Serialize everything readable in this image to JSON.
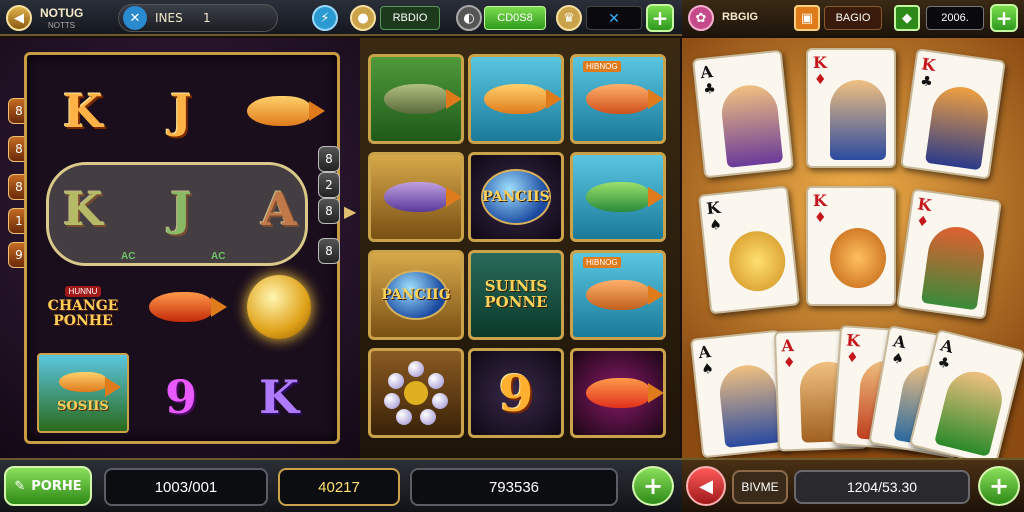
{
  "topbar": {
    "logo_title": "NOTUG",
    "logo_sub": "NOTTS",
    "lines_label": "INES",
    "lines_value": "1",
    "mode_label": "RBDIO",
    "coins_value": "CD0S8",
    "right_label": "RBGIG",
    "bonus_label": "BAGIO",
    "balance_value": "2006."
  },
  "slot": {
    "rows": [
      [
        "K",
        "J",
        ""
      ],
      [
        "K",
        "J",
        "A"
      ],
      [
        "",
        "",
        ""
      ],
      [
        "",
        "9",
        "K"
      ]
    ],
    "left_numbers": [
      "8",
      "8",
      "8",
      "1",
      "9"
    ],
    "right_numbers": [
      "8",
      "2",
      "8",
      "8"
    ],
    "win_tags": [
      "AC",
      "AC"
    ],
    "banner_tag": "HUNNU",
    "banner_text": "CHANGE PONHE",
    "bottom_banner": "SOSIIS"
  },
  "grid": {
    "tiles": [
      {
        "label": "",
        "tag": ""
      },
      {
        "label": "",
        "tag": ""
      },
      {
        "label": "",
        "tag": "HIBNOG"
      },
      {
        "label": "",
        "tag": ""
      },
      {
        "label": "PANCIIS",
        "tag": ""
      },
      {
        "label": "",
        "tag": ""
      },
      {
        "label": "PANCIIG",
        "tag": ""
      },
      {
        "label": "SUINIS PONNE",
        "tag": ""
      },
      {
        "label": "",
        "tag": "HIBNOG"
      },
      {
        "label": "",
        "tag": ""
      },
      {
        "label": "9",
        "tag": ""
      },
      {
        "label": "",
        "tag": ""
      }
    ]
  },
  "cards": {
    "row1": [
      {
        "rank": "A",
        "color": "black"
      },
      {
        "rank": "K",
        "color": "red"
      },
      {
        "rank": "K",
        "color": "red"
      }
    ],
    "row2": [
      {
        "rank": "K",
        "color": "black"
      },
      {
        "rank": "K",
        "color": "red"
      },
      {
        "rank": "K",
        "color": "red"
      }
    ],
    "row3": [
      {
        "rank": "A",
        "color": "black"
      },
      {
        "rank": "A",
        "color": "red"
      },
      {
        "rank": "K",
        "color": "red"
      },
      {
        "rank": "A",
        "color": "black"
      },
      {
        "rank": "A",
        "color": "black"
      }
    ]
  },
  "bottombar": {
    "spin_label": "PORHE",
    "total_bet": "1003/001",
    "win_value": "40217",
    "credits": "793536",
    "back_label": "BIVME",
    "right_credits": "1204/53.30"
  },
  "colors": {
    "accent_gold": "#c9a24a",
    "button_green": "#2e8a18",
    "card_red": "#c4161c"
  }
}
